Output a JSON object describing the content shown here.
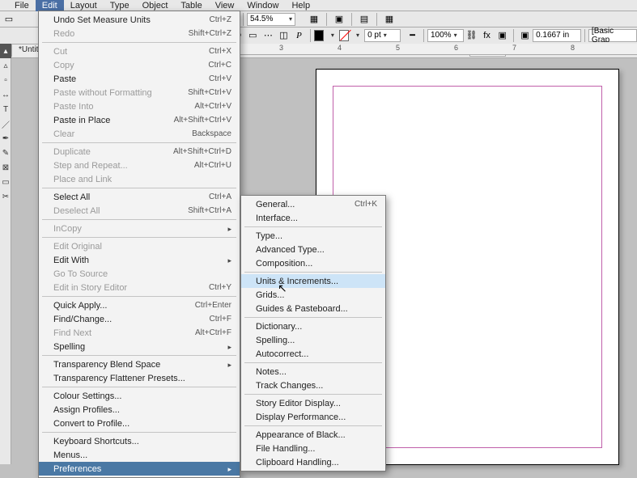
{
  "menubar": {
    "items": [
      "File",
      "Edit",
      "Layout",
      "Type",
      "Object",
      "Table",
      "View",
      "Window",
      "Help"
    ],
    "active_index": 1
  },
  "toolbar": {
    "zoom": "54.5%",
    "stroke_weight": "0 pt",
    "scale": "100%",
    "field1": "0.1667 in",
    "paragraph_style": "[Basic Grap"
  },
  "document": {
    "tab": "*Untitl"
  },
  "ruler_ticks": [
    "3",
    "4",
    "5",
    "6",
    "7",
    "8"
  ],
  "edit_menu": {
    "groups": [
      [
        {
          "label": "Undo Set Measure Units",
          "shortcut": "Ctrl+Z",
          "disabled": false
        },
        {
          "label": "Redo",
          "shortcut": "Shift+Ctrl+Z",
          "disabled": true
        }
      ],
      [
        {
          "label": "Cut",
          "shortcut": "Ctrl+X",
          "disabled": true
        },
        {
          "label": "Copy",
          "shortcut": "Ctrl+C",
          "disabled": true
        },
        {
          "label": "Paste",
          "shortcut": "Ctrl+V",
          "disabled": false
        },
        {
          "label": "Paste without Formatting",
          "shortcut": "Shift+Ctrl+V",
          "disabled": true
        },
        {
          "label": "Paste Into",
          "shortcut": "Alt+Ctrl+V",
          "disabled": true
        },
        {
          "label": "Paste in Place",
          "shortcut": "Alt+Shift+Ctrl+V",
          "disabled": false
        },
        {
          "label": "Clear",
          "shortcut": "Backspace",
          "disabled": true
        }
      ],
      [
        {
          "label": "Duplicate",
          "shortcut": "Alt+Shift+Ctrl+D",
          "disabled": true
        },
        {
          "label": "Step and Repeat...",
          "shortcut": "Alt+Ctrl+U",
          "disabled": true
        },
        {
          "label": "Place and Link",
          "shortcut": "",
          "disabled": true
        }
      ],
      [
        {
          "label": "Select All",
          "shortcut": "Ctrl+A",
          "disabled": false
        },
        {
          "label": "Deselect All",
          "shortcut": "Shift+Ctrl+A",
          "disabled": true
        }
      ],
      [
        {
          "label": "InCopy",
          "shortcut": "",
          "disabled": true,
          "submenu": true
        }
      ],
      [
        {
          "label": "Edit Original",
          "shortcut": "",
          "disabled": true
        },
        {
          "label": "Edit With",
          "shortcut": "",
          "disabled": false,
          "submenu": true
        },
        {
          "label": "Go To Source",
          "shortcut": "",
          "disabled": true
        },
        {
          "label": "Edit in Story Editor",
          "shortcut": "Ctrl+Y",
          "disabled": true
        }
      ],
      [
        {
          "label": "Quick Apply...",
          "shortcut": "Ctrl+Enter",
          "disabled": false
        },
        {
          "label": "Find/Change...",
          "shortcut": "Ctrl+F",
          "disabled": false
        },
        {
          "label": "Find Next",
          "shortcut": "Alt+Ctrl+F",
          "disabled": true
        },
        {
          "label": "Spelling",
          "shortcut": "",
          "disabled": false,
          "submenu": true
        }
      ],
      [
        {
          "label": "Transparency Blend Space",
          "shortcut": "",
          "disabled": false,
          "submenu": true
        },
        {
          "label": "Transparency Flattener Presets...",
          "shortcut": "",
          "disabled": false
        }
      ],
      [
        {
          "label": "Colour Settings...",
          "shortcut": "",
          "disabled": false
        },
        {
          "label": "Assign Profiles...",
          "shortcut": "",
          "disabled": false
        },
        {
          "label": "Convert to Profile...",
          "shortcut": "",
          "disabled": false
        }
      ],
      [
        {
          "label": "Keyboard Shortcuts...",
          "shortcut": "",
          "disabled": false
        },
        {
          "label": "Menus...",
          "shortcut": "",
          "disabled": false
        },
        {
          "label": "Preferences",
          "shortcut": "",
          "disabled": false,
          "submenu": true,
          "active": true
        }
      ]
    ]
  },
  "prefs_menu": {
    "groups": [
      [
        {
          "label": "General...",
          "shortcut": "Ctrl+K"
        },
        {
          "label": "Interface..."
        }
      ],
      [
        {
          "label": "Type..."
        },
        {
          "label": "Advanced Type..."
        },
        {
          "label": "Composition..."
        }
      ],
      [
        {
          "label": "Units & Increments...",
          "highlight": true
        },
        {
          "label": "Grids..."
        },
        {
          "label": "Guides & Pasteboard..."
        }
      ],
      [
        {
          "label": "Dictionary..."
        },
        {
          "label": "Spelling..."
        },
        {
          "label": "Autocorrect..."
        }
      ],
      [
        {
          "label": "Notes..."
        },
        {
          "label": "Track Changes..."
        }
      ],
      [
        {
          "label": "Story Editor Display..."
        },
        {
          "label": "Display Performance..."
        }
      ],
      [
        {
          "label": "Appearance of Black..."
        },
        {
          "label": "File Handling..."
        },
        {
          "label": "Clipboard Handling..."
        }
      ]
    ]
  }
}
